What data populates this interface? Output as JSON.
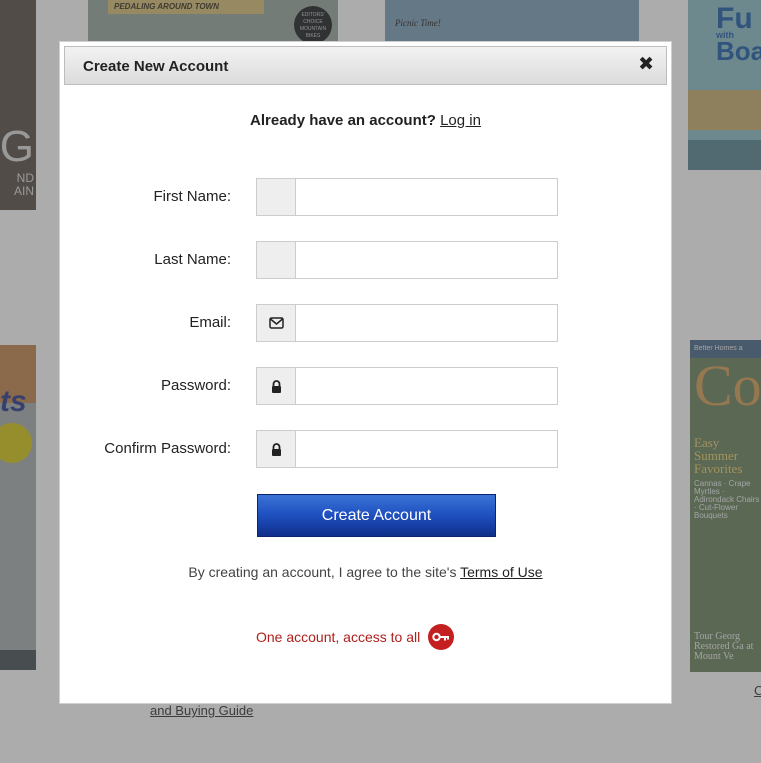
{
  "background": {
    "mag1": {
      "big": "G",
      "lines": [
        "ND",
        "AIN"
      ]
    },
    "mag2": {
      "band": "PEDALING AROUND TOWN",
      "badge": "EDITORS' CHOICE MOUNTAIN BIKES"
    },
    "mag3": {
      "text": "Picnic Time!"
    },
    "mag4": {
      "line1": "Fu",
      "line2": "with",
      "line3": "Boa"
    },
    "mag5": {
      "text": "ts"
    },
    "mag6": {
      "header": "Better Homes a",
      "big": "Co",
      "feature": "Easy Summer Favorites",
      "list": "Cannas · Crape Myrtles · Adirondack Chairs · Cut-Flower Bouquets",
      "footer": "Tour Georg Restored Ga at Mount Ve"
    },
    "link_bottom": "and Buying Guide",
    "link_right": "C"
  },
  "modal": {
    "title": "Create New Account",
    "close_symbol": "✖",
    "login_prompt": "Already have an account?",
    "login_link": "Log in",
    "fields": {
      "first_name": {
        "label": "First Name:",
        "value": "",
        "placeholder": ""
      },
      "last_name": {
        "label": "Last Name:",
        "value": "",
        "placeholder": ""
      },
      "email": {
        "label": "Email:",
        "value": "",
        "placeholder": ""
      },
      "password": {
        "label": "Password:",
        "value": "",
        "placeholder": ""
      },
      "confirm_password": {
        "label": "Confirm Password:",
        "value": "",
        "placeholder": ""
      }
    },
    "icons": {
      "email": "envelope-icon",
      "password": "lock-icon",
      "confirm_password": "lock-icon",
      "promo": "key-icon"
    },
    "submit_label": "Create Account",
    "terms_prefix": "By creating an account, I agree to the site's",
    "terms_link": "Terms of Use",
    "promo_text": "One account, access to all",
    "colors": {
      "accent": "#1e4fbf",
      "promo": "#b0201c"
    }
  }
}
